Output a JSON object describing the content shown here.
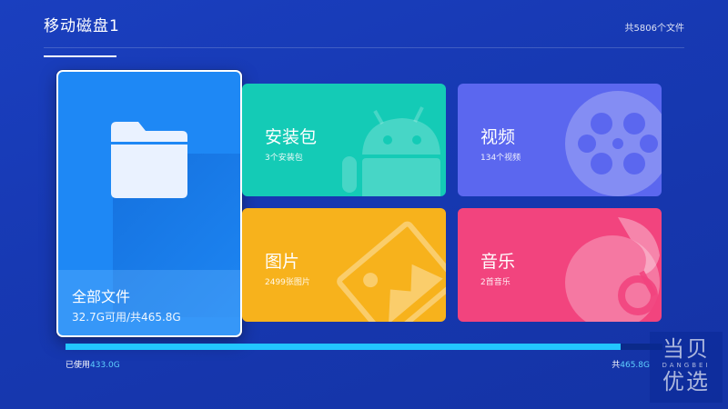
{
  "header": {
    "tab_label": "移动磁盘1",
    "file_count": "共5806个文件"
  },
  "cards": {
    "all": {
      "title": "全部文件",
      "subtitle": "32.7G可用/共465.8G",
      "icon": "folder-icon"
    },
    "apk": {
      "title": "安装包",
      "subtitle": "3个安装包",
      "icon": "android-icon"
    },
    "video": {
      "title": "视频",
      "subtitle": "134个视频",
      "icon": "film-reel-icon"
    },
    "picture": {
      "title": "图片",
      "subtitle": "2499张图片",
      "icon": "image-icon"
    },
    "music": {
      "title": "音乐",
      "subtitle": "2首音乐",
      "icon": "music-note-icon"
    }
  },
  "storage": {
    "used_label": "已使用",
    "used_value": "433.0G",
    "total_label": "共",
    "total_value": "465.8G",
    "used_fraction": 0.93
  },
  "watermark": {
    "top": "当贝",
    "middle": "DANGBEI",
    "bottom": "优选"
  },
  "colors": {
    "background": "#1739b3",
    "all_files": "#1e88f5",
    "apk": "#14cbb6",
    "video": "#5b67ef",
    "picture": "#f7b21c",
    "music": "#f2447e",
    "progress": "#22c6ff"
  }
}
